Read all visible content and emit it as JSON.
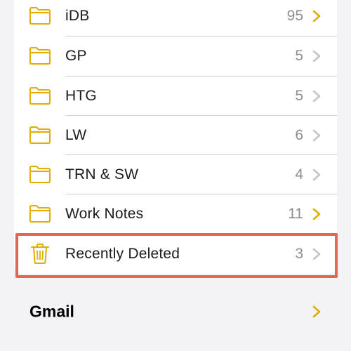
{
  "colors": {
    "accent": "#e2ac00",
    "highlight_border": "#e0675a",
    "count_text": "#8e8e93",
    "chevron_gray": "#c4c4c8"
  },
  "folders": [
    {
      "label": "iDB",
      "count": "95",
      "icon": "folder-icon",
      "chevron": "accent"
    },
    {
      "label": "GP",
      "count": "5",
      "icon": "folder-icon",
      "chevron": "gray"
    },
    {
      "label": "HTG",
      "count": "5",
      "icon": "folder-icon",
      "chevron": "gray"
    },
    {
      "label": "LW",
      "count": "6",
      "icon": "folder-icon",
      "chevron": "gray"
    },
    {
      "label": "TRN & SW",
      "count": "4",
      "icon": "folder-icon",
      "chevron": "gray"
    },
    {
      "label": "Work Notes",
      "count": "11",
      "icon": "folder-icon",
      "chevron": "accent"
    },
    {
      "label": "Recently Deleted",
      "count": "3",
      "icon": "trash-icon",
      "chevron": "gray"
    }
  ],
  "account_section": {
    "title": "Gmail"
  }
}
